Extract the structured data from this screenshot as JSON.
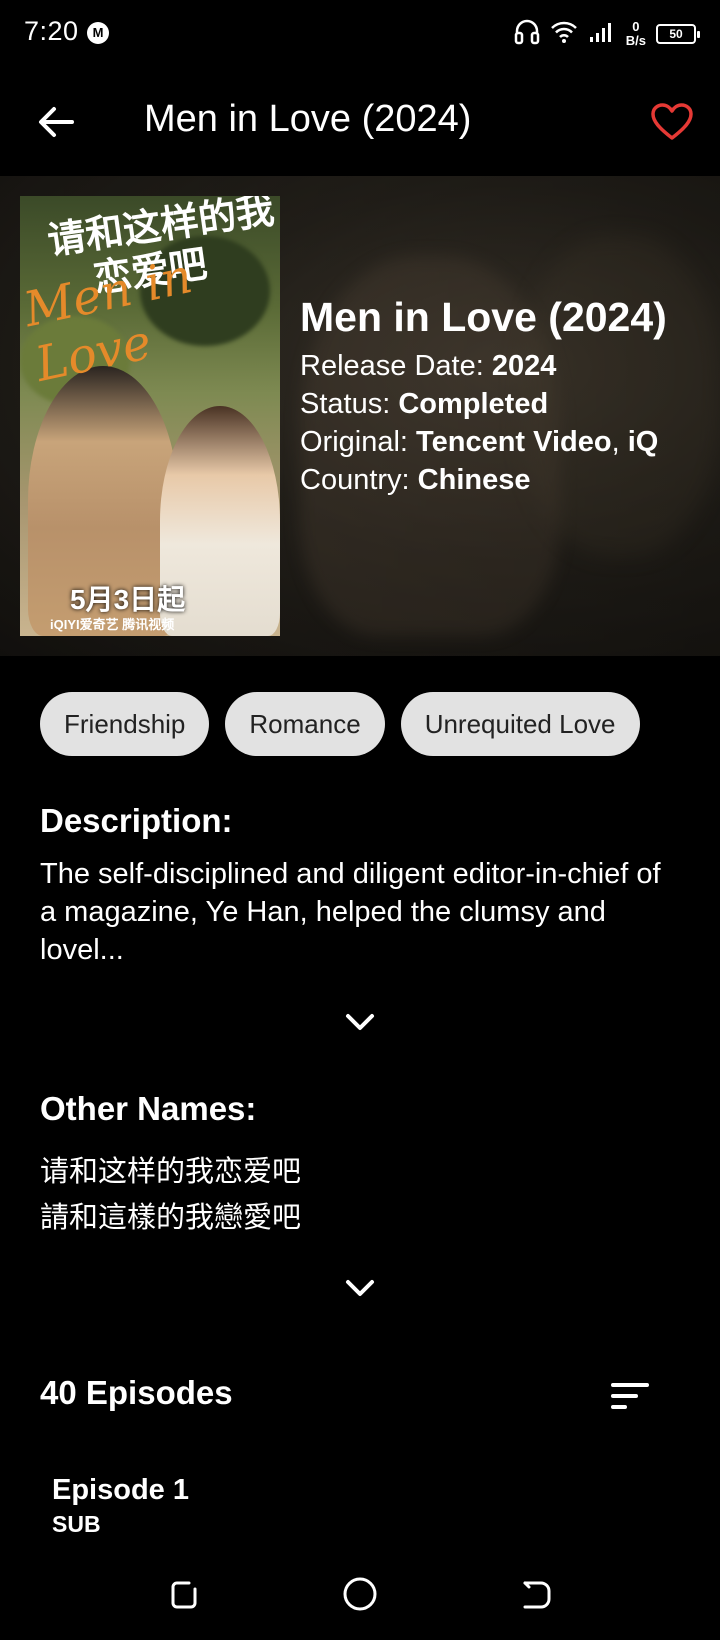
{
  "status_bar": {
    "time": "7:20",
    "app_icon_letter": "M",
    "net_speed_value": "0",
    "net_speed_unit": "B/s",
    "battery": "50"
  },
  "app_bar": {
    "title": "Men in Love (2024)",
    "back_icon": "arrow-left-icon",
    "favorite_icon": "heart-outline-icon",
    "favorite_color": "#e53935"
  },
  "poster": {
    "cn_title_line1": "请和这样的我",
    "cn_title_line2": "恋爱吧",
    "en_script": "Men in Love",
    "date_text": "5月3日起",
    "logos_text": "iQIYI爱奇艺 腾讯视频"
  },
  "hero": {
    "title": "Men in Love (2024)",
    "release_label": "Release Date: ",
    "release_value": "2024",
    "status_label": "Status: ",
    "status_value": "Completed",
    "original_label": "Original: ",
    "original_value1": "Tencent Video",
    "original_sep": ", ",
    "original_value2": "iQ",
    "country_label": "Country: ",
    "country_value": "Chinese"
  },
  "tags": [
    "Friendship",
    "Romance",
    "Unrequited Love"
  ],
  "description": {
    "heading": "Description:",
    "text": "The self-disciplined and diligent editor-in-chief of a magazine, Ye Han, helped the clumsy and lovel...",
    "expand_icon": "chevron-down-icon"
  },
  "other_names": {
    "heading": "Other Names:",
    "names": [
      "请和这样的我恋爱吧",
      "請和這樣的我戀愛吧"
    ],
    "expand_icon": "chevron-down-icon"
  },
  "episodes": {
    "heading": "40 Episodes",
    "sort_icon": "sort-icon",
    "items": [
      {
        "title": "Episode 1",
        "badge": "SUB"
      }
    ]
  },
  "nav_bar": {
    "recents_icon": "recents-icon",
    "home_icon": "home-circle-icon",
    "back_icon": "nav-back-icon"
  }
}
